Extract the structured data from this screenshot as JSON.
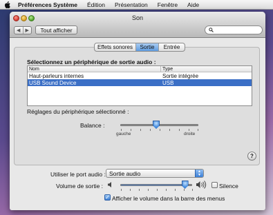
{
  "menubar": {
    "app_name": "Préférences Système",
    "items": [
      "Édition",
      "Présentation",
      "Fenêtre",
      "Aide"
    ]
  },
  "window": {
    "title": "Son",
    "show_all_label": "Tout afficher",
    "search_placeholder": ""
  },
  "tabs": [
    {
      "label": "Effets sonores",
      "selected": false
    },
    {
      "label": "Sortie",
      "selected": true
    },
    {
      "label": "Entrée",
      "selected": false
    }
  ],
  "output": {
    "heading": "Sélectionnez un périphérique de sortie audio :",
    "columns": [
      "Nom",
      "Type"
    ],
    "devices": [
      {
        "name": "Haut-parleurs internes",
        "type": "Sortie intégrée",
        "selected": false
      },
      {
        "name": "USB Sound Device",
        "type": "USB",
        "selected": true
      }
    ]
  },
  "selected_device": {
    "heading": "Réglages du périphérique sélectionné :",
    "balance_label": "Balance :",
    "balance_left": "gauche",
    "balance_right": "droite",
    "balance_value": 0.5
  },
  "help_label": "?",
  "audio_port": {
    "label": "Utiliser le port audio :",
    "value": "Sortie audio"
  },
  "volume": {
    "label": "Volume de sortie :",
    "level": 0.9,
    "mute_label": "Silence",
    "muted": false
  },
  "show_volume_in_menubar": {
    "label": "Afficher le volume dans la barre des menus",
    "checked": true
  },
  "colors": {
    "selection": "#3b6fc6",
    "accent": "#3e86dc"
  }
}
